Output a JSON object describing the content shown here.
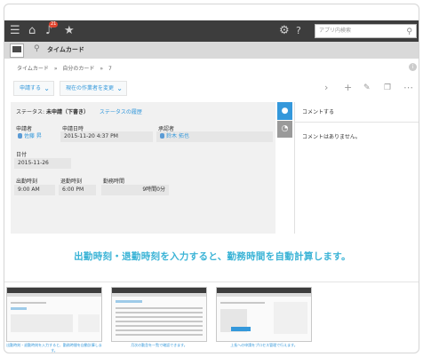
{
  "topbar": {
    "notification_count": "21",
    "search_placeholder": "アプリ内検索"
  },
  "app": {
    "title": "タイムカード"
  },
  "breadcrumb": [
    "タイムカード",
    "»",
    "自分のカード",
    "»",
    "7"
  ],
  "actions": {
    "apply_label": "申請する",
    "change_assignee_label": "現在の作業者を変更"
  },
  "record": {
    "status_label": "ステータス:",
    "status_value": "未申請（下書き）",
    "history_link": "ステータスの履歴",
    "fields": {
      "applicant_label": "申請者",
      "applicant_value": "佐藤 昇",
      "applied_at_label": "申請日時",
      "applied_at_value": "2015-11-20 4:37 PM",
      "approver_label": "承認者",
      "approver_value": "鈴木 拓也",
      "date_label": "日付",
      "date_value": "2015-11-26",
      "clock_in_label": "出勤時刻",
      "clock_in_value": "9:00 AM",
      "clock_out_label": "退勤時刻",
      "clock_out_value": "6:00 PM",
      "work_time_label": "勤務時間",
      "work_time_value": "9時間0分"
    }
  },
  "comments": {
    "title": "コメントする",
    "empty_text": "コメントはありません。"
  },
  "caption": "出勤時刻・退勤時刻を入力すると、勤務時間を自動計算します。",
  "thumbnails": [
    {
      "caption": "出勤時刻・退勤時刻を入力すると、勤務時間を自動計算します。"
    },
    {
      "caption": "月次の勤怠を一覧で確認できます。"
    },
    {
      "caption": "上長への申請をプロセス管理で行えます。"
    }
  ],
  "colors": {
    "accent": "#3498db",
    "caption": "#3ab3d6",
    "header": "#3d3d3d",
    "badge": "#e0452f"
  }
}
